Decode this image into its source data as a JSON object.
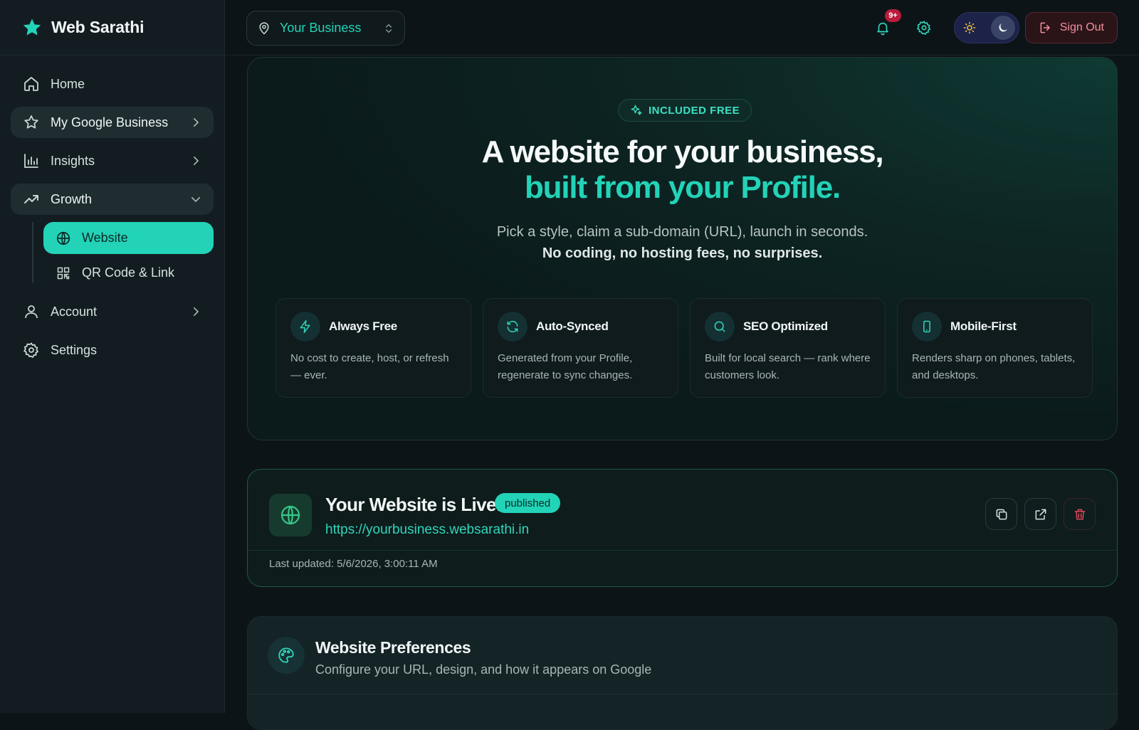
{
  "app": {
    "name": "Web Sarathi"
  },
  "sidebar": {
    "items": [
      {
        "label": "Home"
      },
      {
        "label": "My Google Business"
      },
      {
        "label": "Insights"
      },
      {
        "label": "Growth"
      },
      {
        "label": "Account"
      },
      {
        "label": "Settings"
      }
    ],
    "growth_sub": [
      {
        "label": "Website"
      },
      {
        "label": "QR Code & Link"
      }
    ]
  },
  "topbar": {
    "business": "Your Business",
    "notification_count": "9+",
    "sign_out": "Sign Out"
  },
  "hero": {
    "pill": "INCLUDED FREE",
    "title_line1": "A website for your business,",
    "title_line2": "built from your Profile.",
    "subtitle": "Pick a style, claim a sub-domain (URL), launch in seconds.",
    "subtitle_strong": "No coding, no hosting fees, no surprises.",
    "features": [
      {
        "title": "Always Free",
        "desc": "No cost to create, host, or refresh — ever.",
        "icon": "bolt-icon"
      },
      {
        "title": "Auto-Synced",
        "desc": "Generated from your Profile, regenerate to sync changes.",
        "icon": "refresh-icon"
      },
      {
        "title": "SEO Optimized",
        "desc": "Built for local search — rank where customers look.",
        "icon": "search-icon"
      },
      {
        "title": "Mobile-First",
        "desc": "Renders sharp on phones, tablets, and desktops.",
        "icon": "phone-icon"
      }
    ]
  },
  "live": {
    "title": "Your Website is Live!",
    "status": "published",
    "url": "https://yourbusiness.websarathi.in",
    "last_updated": "Last updated: 5/6/2026, 3:00:11 AM"
  },
  "prefs": {
    "title": "Website Preferences",
    "subtitle": "Configure your URL, design, and how it appears on Google"
  },
  "colors": {
    "accent": "#22d3b7",
    "background": "#0c1417",
    "sidebar": "#131d21",
    "danger": "#f58f9c"
  }
}
